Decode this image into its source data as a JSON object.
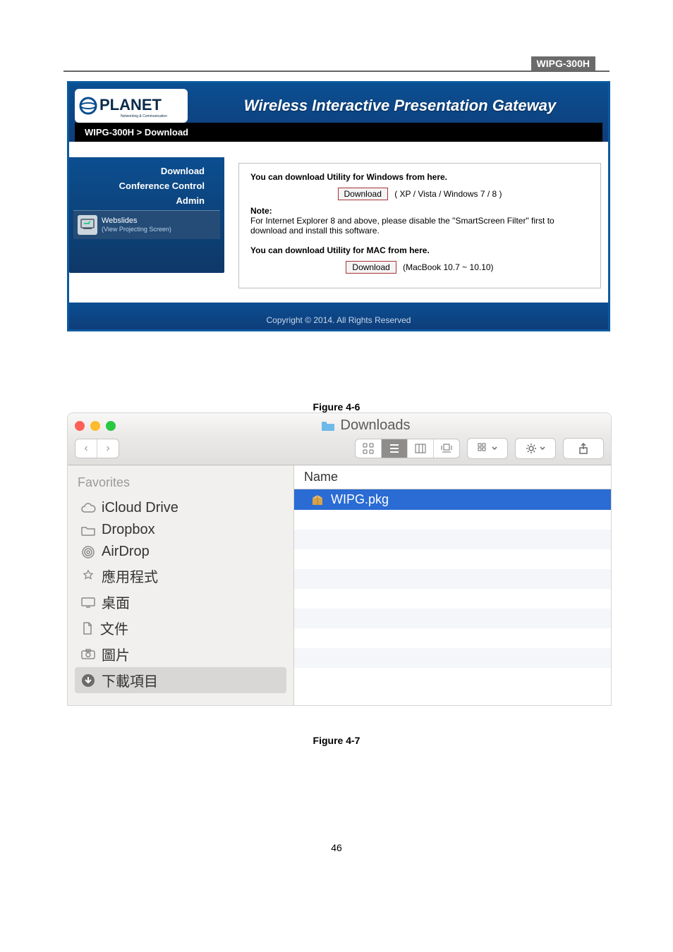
{
  "header": {
    "model": "WIPG-300H"
  },
  "figure1": {
    "banner_title": "Wireless Interactive Presentation Gateway",
    "logo_main": "PLANET",
    "logo_sub": "Networking & Communication",
    "breadcrumb": "WIPG-300H > Download",
    "sidebar": {
      "links": [
        "Download",
        "Conference Control",
        "Admin"
      ],
      "webslides_title": "Webslides",
      "webslides_sub": "(View Projecting Screen)"
    },
    "content": {
      "win_head": "You can download Utility for Windows from here.",
      "win_btn": "Download",
      "win_note_compat": "( XP / Vista / Windows 7 / 8 )",
      "note_label": "Note:",
      "note_body": "For Internet Explorer 8 and above, please disable the \"SmartScreen Filter\" first to download and install this software.",
      "mac_head": "You can download Utility for MAC from here.",
      "mac_btn": "Download",
      "mac_note_compat": "(MacBook 10.7 ~ 10.10)"
    },
    "copyright": "Copyright © 2014. All Rights Reserved",
    "caption": "Figure 4-6"
  },
  "finder": {
    "window_title": "Downloads",
    "sidebar_header": "Favorites",
    "sidebar_items": [
      {
        "label": "iCloud Drive",
        "icon": "cloud"
      },
      {
        "label": "Dropbox",
        "icon": "folder"
      },
      {
        "label": "AirDrop",
        "icon": "airdrop"
      },
      {
        "label": "應用程式",
        "icon": "apps"
      },
      {
        "label": "桌面",
        "icon": "desktop"
      },
      {
        "label": "文件",
        "icon": "docs"
      },
      {
        "label": "圖片",
        "icon": "pictures"
      },
      {
        "label": "下載項目",
        "icon": "downloads",
        "selected": true
      }
    ],
    "column_header": "Name",
    "files": [
      {
        "name": "WIPG.pkg",
        "selected": true
      }
    ],
    "caption": "Figure 4-7"
  },
  "page_number": "46"
}
